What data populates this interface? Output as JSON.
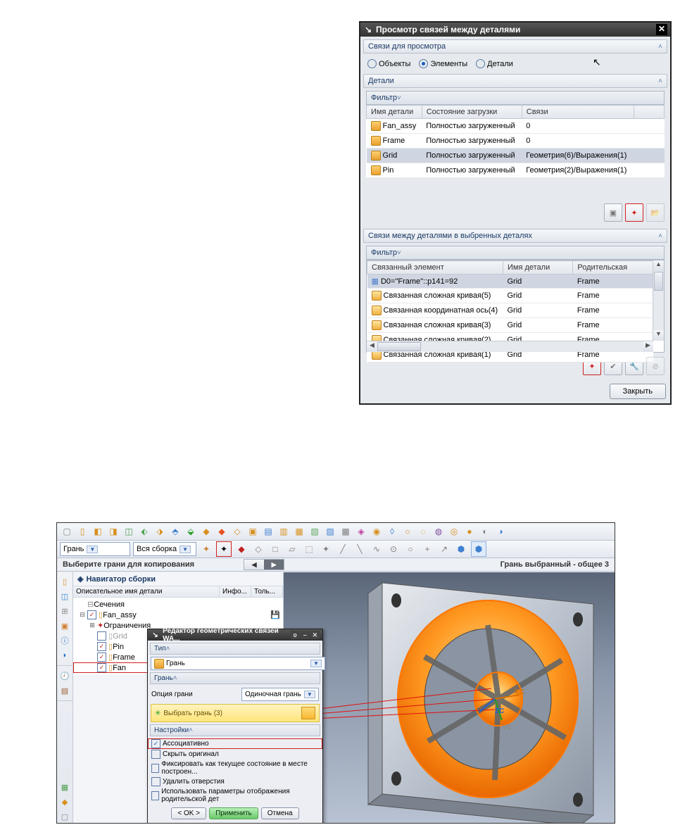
{
  "dlg1": {
    "title": "Просмотр связей между деталями",
    "section_links": "Связи для просмотра",
    "radio_objects": "Объекты",
    "radio_elements": "Элементы",
    "radio_details": "Детали",
    "section_details": "Детали",
    "filter": "Фильтр",
    "col_partname": "Имя детали",
    "col_loadstate": "Состояние загрузки",
    "col_links": "Связи",
    "rows": [
      {
        "name": "Fan_assy",
        "state": "Полностью загруженный",
        "links": "0"
      },
      {
        "name": "Frame",
        "state": "Полностью загруженный",
        "links": "0"
      },
      {
        "name": "Grid",
        "state": "Полностью загруженный",
        "links": "Геометрия(6)/Выражения(1)"
      },
      {
        "name": "Pin",
        "state": "Полностью загруженный",
        "links": "Геометрия(2)/Выражения(1)"
      }
    ],
    "section_links2": "Связи между деталями в выбренных деталях",
    "col_linkedel": "Связанный элемент",
    "col_partname2": "Имя детали",
    "col_parent": "Родительская",
    "rows2": [
      {
        "el": "D0=\"Frame\"::p141=92",
        "part": "Grid",
        "parent": "Frame"
      },
      {
        "el": "Связанная сложная кривая(5)",
        "part": "Grid",
        "parent": "Frame"
      },
      {
        "el": "Связанная координатная ось(4)",
        "part": "Grid",
        "parent": "Frame"
      },
      {
        "el": "Связанная сложная кривая(3)",
        "part": "Grid",
        "parent": "Frame"
      },
      {
        "el": "Связанная сложная кривая(2)",
        "part": "Grid",
        "parent": "Frame"
      },
      {
        "el": "Связанная сложная кривая(1)",
        "part": "Grid",
        "parent": "Frame"
      }
    ],
    "close": "Закрыть"
  },
  "app": {
    "combo_face": "Грань",
    "combo_assy": "Вся сборка",
    "prompt": "Выберите грани для копирования",
    "status_right": "Грань выбранный - общее 3",
    "nav_title": "Навигатор сборки",
    "nav_col_name": "Описательное имя детали",
    "nav_col_info": "Инфо...",
    "nav_col_only": "Толь...",
    "tree": {
      "sections": "Сечения",
      "root": "Fan_assy",
      "constraints": "Ограничения",
      "grid": "Grid",
      "pin": "Pin",
      "frame": "Frame",
      "fan": "Fan"
    }
  },
  "dlg2": {
    "title": "Редактор геометрических связей WA...",
    "sect_type": "Тип",
    "type_val": "Грань",
    "sect_face": "Грань",
    "opt_face_lbl": "Опция грани",
    "opt_face_val": "Одиночная грань",
    "select_face": "Выбрать грань (3)",
    "sect_settings": "Настройки",
    "chk_assoc": "Ассоциативно",
    "chk_hide": "Скрыть оригинал",
    "chk_fix": "Фиксировать как текущее состояние в месте построен...",
    "chk_del": "Удалить отверстия",
    "chk_inherit": "Использовать параметры отображения родительской дет",
    "btn_ok": "< OK >",
    "btn_apply": "Применить",
    "btn_cancel": "Отмена"
  },
  "axes": {
    "xc": "XC",
    "yc": "YC",
    "zc": "ZC"
  }
}
